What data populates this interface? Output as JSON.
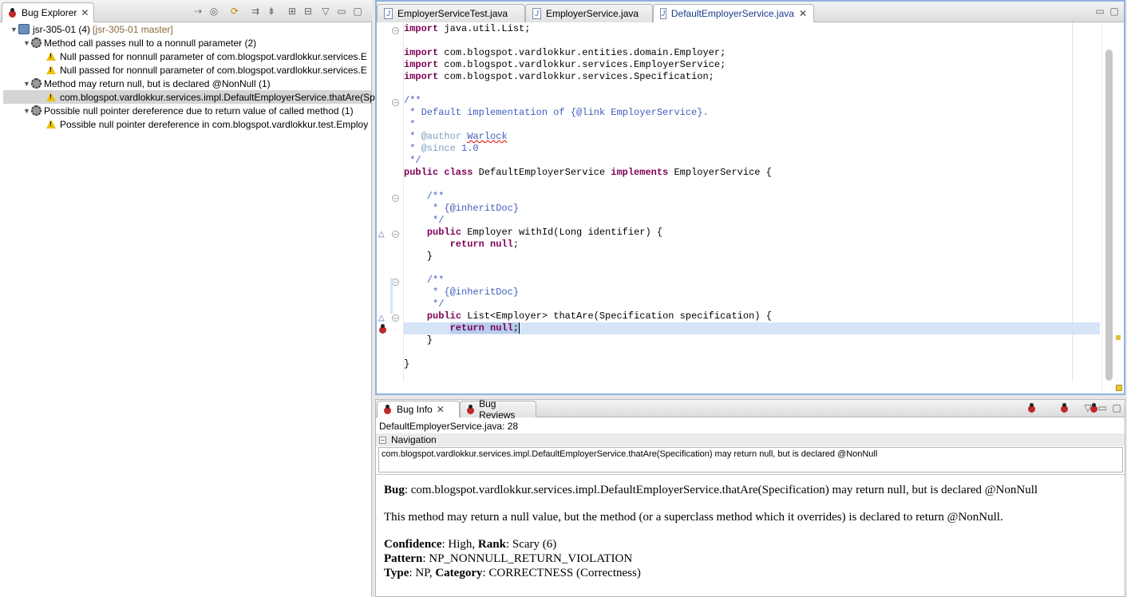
{
  "left_view": {
    "tab_label": "Bug Explorer",
    "tree": [
      {
        "text": "jsr-305-01 (4)",
        "suffix": "[jsr-305-01 master]"
      },
      {
        "text": "Method call passes null to a nonnull parameter  (2)"
      },
      {
        "text": "Null passed for nonnull parameter of com.blogspot.vardlokkur.services.E"
      },
      {
        "text": "Null passed for nonnull parameter of com.blogspot.vardlokkur.services.E"
      },
      {
        "text": "Method may return null, but is declared @NonNull (1)"
      },
      {
        "text": "com.blogspot.vardlokkur.services.impl.DefaultEmployerService.thatAre(Sp"
      },
      {
        "text": "Possible null pointer dereference due to return value of called method (1)"
      },
      {
        "text": "Possible null pointer dereference in com.blogspot.vardlokkur.test.Employ"
      }
    ]
  },
  "editor": {
    "tabs": [
      "EmployerServiceTest.java",
      "EmployerService.java",
      "DefaultEmployerService.java"
    ],
    "active_tab": 2
  },
  "bottom_view": {
    "tabs": [
      "Bug Info",
      "Bug Reviews"
    ],
    "location": "DefaultEmployerService.java: 28",
    "navigation_label": "Navigation",
    "navigation_item": "com.blogspot.vardlokkur.services.impl.DefaultEmployerService.thatAre(Specification) may return null, but is declared @NonNull",
    "bug_label": "Bug",
    "bug_text": ": com.blogspot.vardlokkur.services.impl.DefaultEmployerService.thatAre(Specification) may return null, but is declared @NonNull",
    "description": "This method may return a null value, but the method (or a superclass method which it overrides) is declared to return @NonNull.",
    "confidence_label": "Confidence",
    "confidence_value": ": High, ",
    "rank_label": "Rank",
    "rank_value": ": Scary (6)",
    "pattern_label": "Pattern",
    "pattern_value": ": NP_NONNULL_RETURN_VIOLATION",
    "type_label": "Type",
    "type_value": ": NP, ",
    "category_label": "Category",
    "category_value": ": CORRECTNESS (Correctness)"
  }
}
